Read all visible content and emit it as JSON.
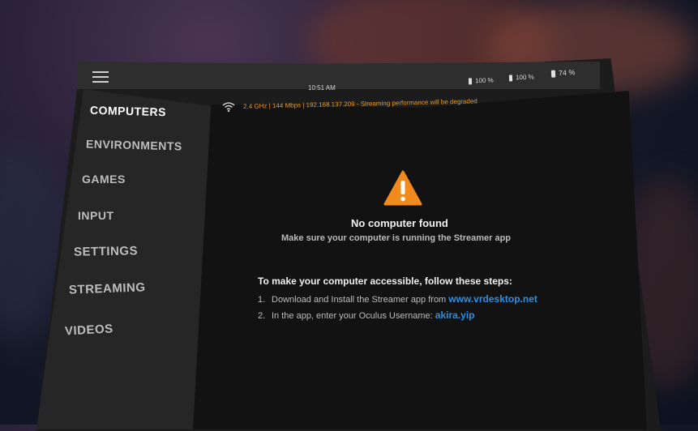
{
  "topbar": {
    "time": "10:51 AM",
    "batteries": [
      {
        "label": "100 %",
        "icon": "controller-battery-icon"
      },
      {
        "label": "100 %",
        "icon": "controller-battery-icon"
      },
      {
        "label": "74 %",
        "icon": "headset-battery-icon"
      }
    ]
  },
  "status": {
    "message": "2.4 GHz | 144 Mbps | 192.168.137.209 - Streaming performance will be degraded",
    "color": "#e69a2e"
  },
  "sidebar": {
    "items": [
      {
        "label": "COMPUTERS",
        "active": true
      },
      {
        "label": "ENVIRONMENTS"
      },
      {
        "label": "GAMES"
      },
      {
        "label": "INPUT"
      },
      {
        "label": "SETTINGS"
      },
      {
        "label": "STREAMING"
      },
      {
        "label": "VIDEOS"
      }
    ]
  },
  "main": {
    "title": "No computer found",
    "subtitle": "Make sure your computer is running the Streamer app",
    "steps_title": "To make your computer accessible, follow these steps:",
    "steps": [
      {
        "num": "1.",
        "text": "Download and Install the Streamer app from ",
        "link": "www.vrdesktop.net"
      },
      {
        "num": "2.",
        "text": "In the app, enter your Oculus Username: ",
        "link": "akira.yip"
      }
    ],
    "warning_color": "#f08a1c",
    "link_color": "#2f8fe0"
  }
}
